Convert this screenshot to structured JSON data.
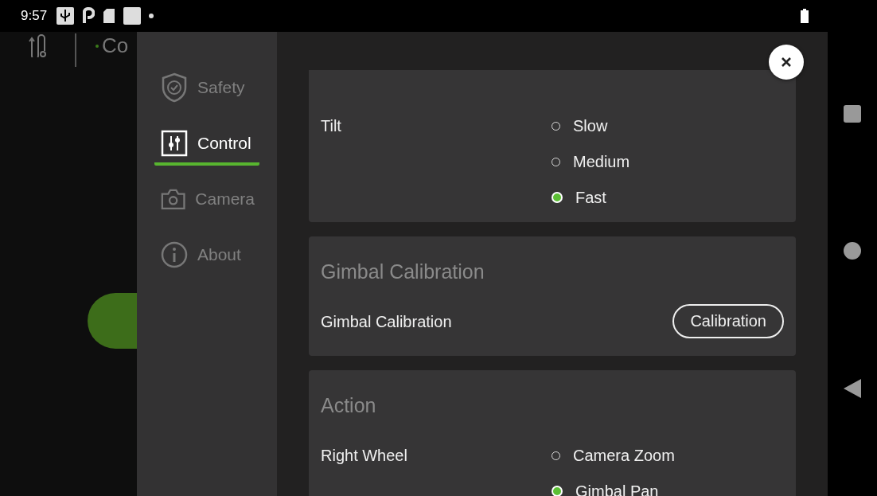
{
  "status_bar": {
    "time": "9:57"
  },
  "background_app": {
    "title": "Co"
  },
  "sidebar": {
    "items": [
      {
        "label": "Safety",
        "selected": false
      },
      {
        "label": "Control",
        "selected": true
      },
      {
        "label": "Camera",
        "selected": false
      },
      {
        "label": "About",
        "selected": false
      }
    ]
  },
  "sections": [
    {
      "rows": [
        {
          "kind": "radio",
          "label": "Tilt",
          "options": [
            {
              "label": "Slow",
              "selected": false
            },
            {
              "label": "Medium",
              "selected": false
            },
            {
              "label": "Fast",
              "selected": true
            }
          ]
        }
      ]
    },
    {
      "title": "Gimbal Calibration",
      "rows": [
        {
          "kind": "button",
          "label": "Gimbal Calibration",
          "button": "Calibration"
        }
      ]
    },
    {
      "title": "Action",
      "rows": [
        {
          "kind": "radio",
          "label": "Right Wheel",
          "options": [
            {
              "label": "Camera Zoom",
              "selected": false
            },
            {
              "label": "Gimbal Pan",
              "selected": true
            }
          ]
        }
      ]
    }
  ]
}
